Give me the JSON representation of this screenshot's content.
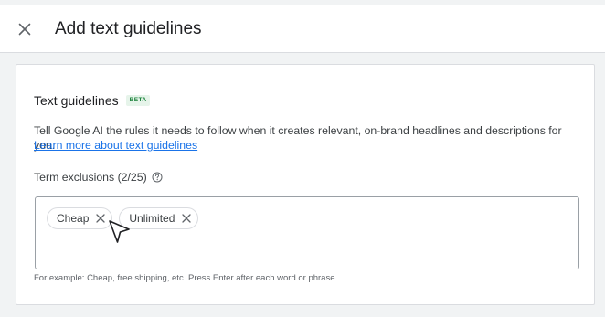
{
  "header": {
    "title": "Add text guidelines",
    "close_icon": "close-icon"
  },
  "card": {
    "title": "Text guidelines",
    "badge": "BETA",
    "description": "Tell Google AI the rules it needs to follow when it creates relevant, on-brand headlines and descriptions for you.",
    "learn_more": "Learn more about text guidelines"
  },
  "term_exclusions": {
    "label": "Term exclusions (2/25)",
    "help_icon": "help-circle-icon",
    "chips": [
      {
        "label": "Cheap"
      },
      {
        "label": "Unlimited"
      }
    ],
    "hint": "For example: Cheap, free shipping, etc. Press Enter after each word or phrase."
  },
  "colors": {
    "link": "#1a73e8",
    "beta_text": "#188038",
    "beta_bg": "#e6f4ea",
    "border": "#dadce0"
  }
}
